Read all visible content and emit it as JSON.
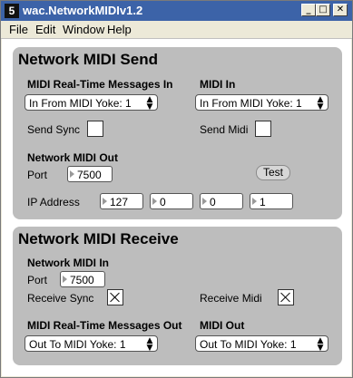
{
  "window": {
    "icon_glyph": "5",
    "title": "wac.NetworkMIDIv1.2",
    "controls": {
      "minimize": "_",
      "maximize": "□",
      "close": "✕"
    }
  },
  "menubar": {
    "items": [
      "File",
      "Edit",
      "Window",
      "Help"
    ]
  },
  "send": {
    "title": "Network MIDI Send",
    "realtime_label": "MIDI Real-Time Messages In",
    "realtime_value": "In From MIDI Yoke:  1",
    "midi_in_label": "MIDI In",
    "midi_in_value": "In From MIDI Yoke:  1",
    "send_sync_label": "Send Sync",
    "send_sync_checked": false,
    "send_midi_label": "Send Midi",
    "send_midi_checked": false,
    "out_label": "Network MIDI Out",
    "port_label": "Port",
    "port_value": "7500",
    "test_label": "Test",
    "ip_label": "IP Address",
    "ip": [
      "127",
      "0",
      "0",
      "1"
    ]
  },
  "receive": {
    "title": "Network MIDI Receive",
    "in_label": "Network MIDI In",
    "port_label": "Port",
    "port_value": "7500",
    "receive_sync_label": "Receive Sync",
    "receive_sync_checked": true,
    "receive_midi_label": "Receive Midi",
    "receive_midi_checked": true,
    "realtime_out_label": "MIDI Real-Time Messages Out",
    "realtime_out_value": "Out To MIDI Yoke:  1",
    "midi_out_label": "MIDI Out",
    "midi_out_value": "Out To MIDI Yoke:  1"
  },
  "icons": {
    "dropdown_arrows": "▲▼"
  }
}
